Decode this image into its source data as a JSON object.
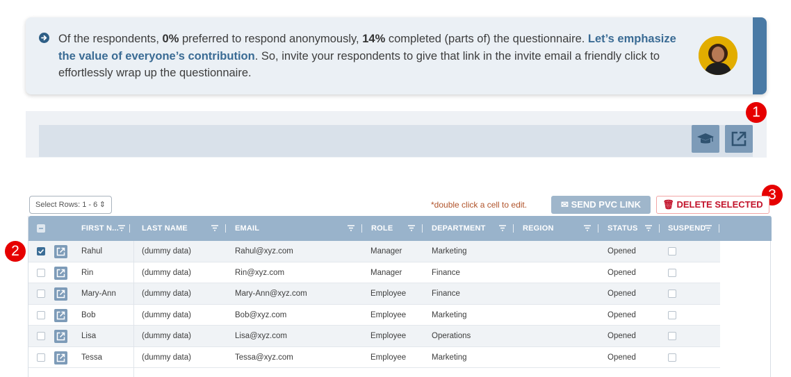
{
  "banner": {
    "prefix": "Of the respondents, ",
    "pct_anon": "0%",
    "mid1": " preferred to respond anonymously, ",
    "pct_done": "14%",
    "mid2": " completed (parts of) the questionnaire. ",
    "highlight": "Let’s emphasize the value of everyone’s contribution",
    "suffix": ". So, invite your respondents to give that link in the invite email a friendly click to effortlessly wrap up the questionnaire."
  },
  "toolbar": {
    "education_icon": "graduation-cap-icon",
    "open_external_icon": "external-link-icon"
  },
  "callouts": [
    "1",
    "2",
    "3"
  ],
  "controls": {
    "select_rows": "Select Rows: 1 - 6",
    "hint": "*double click a cell to edit.",
    "send_pvc": "SEND PVC LINK",
    "delete_selected": "DELETE SELECTED"
  },
  "table": {
    "columns": [
      "FIRST N...",
      "LAST NAME",
      "EMAIL",
      "ROLE",
      "DEPARTMENT",
      "REGION",
      "STATUS",
      "SUSPEND"
    ],
    "rows": [
      {
        "first": "Rahul",
        "last": "(dummy data)",
        "email": "Rahul@xyz.com",
        "role": "Manager",
        "dept": "Marketing",
        "region": "",
        "status": "Opened",
        "selected": true,
        "suspended": false
      },
      {
        "first": "Rin",
        "last": "(dummy data)",
        "email": "Rin@xyz.com",
        "role": "Manager",
        "dept": "Finance",
        "region": "",
        "status": "Opened",
        "selected": false,
        "suspended": false
      },
      {
        "first": "Mary-Ann",
        "last": "(dummy data)",
        "email": "Mary-Ann@xyz.com",
        "role": "Employee",
        "dept": "Finance",
        "region": "",
        "status": "Opened",
        "selected": false,
        "suspended": false
      },
      {
        "first": "Bob",
        "last": "(dummy data)",
        "email": "Bob@xyz.com",
        "role": "Employee",
        "dept": "Marketing",
        "region": "",
        "status": "Opened",
        "selected": false,
        "suspended": false
      },
      {
        "first": "Lisa",
        "last": "(dummy data)",
        "email": "Lisa@xyz.com",
        "role": "Employee",
        "dept": "Operations",
        "region": "",
        "status": "Opened",
        "selected": false,
        "suspended": false
      },
      {
        "first": "Tessa",
        "last": "(dummy data)",
        "email": "Tessa@xyz.com",
        "role": "Employee",
        "dept": "Marketing",
        "region": "",
        "status": "Opened",
        "selected": false,
        "suspended": false
      }
    ]
  },
  "colors": {
    "accent": "#4a7aa5",
    "header": "#99b3cb",
    "danger": "#c2122a",
    "callout": "#e60000"
  }
}
